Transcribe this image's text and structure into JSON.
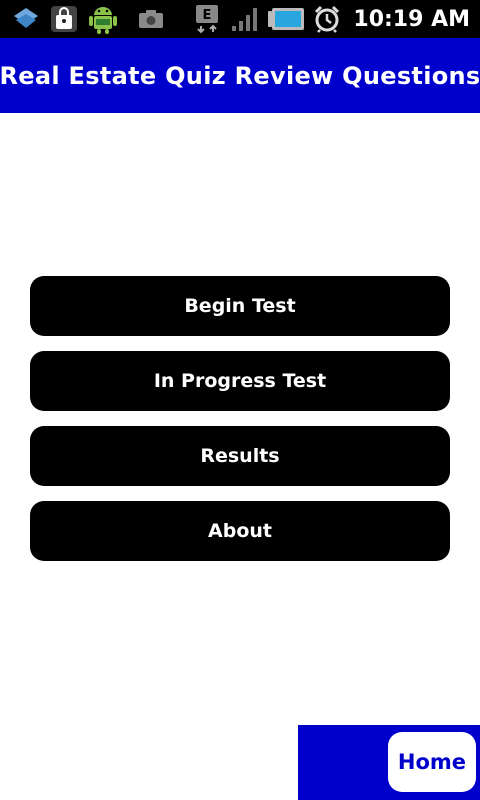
{
  "status_bar": {
    "time": "10:19 AM",
    "network_type": "E",
    "icons": [
      "dropbox-icon",
      "shopping-bag-icon",
      "android-icon",
      "camera-icon",
      "edge-network-icon",
      "signal-icon",
      "battery-icon",
      "alarm-icon"
    ]
  },
  "header": {
    "title": "Real Estate Quiz Review Questions"
  },
  "menu": {
    "items": [
      {
        "label": "Begin Test"
      },
      {
        "label": "In Progress Test"
      },
      {
        "label": "Results"
      },
      {
        "label": "About"
      }
    ]
  },
  "footer": {
    "home_label": "Home"
  },
  "colors": {
    "primary_blue": "#0000cc",
    "button_black": "#000000",
    "background": "#ffffff"
  }
}
